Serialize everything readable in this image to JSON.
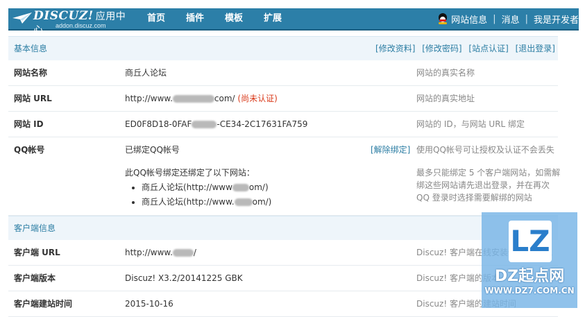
{
  "nav": {
    "brand": "DISCUZ!",
    "brand_suffix": "应用中心",
    "sub_url": "addon.discuz.com",
    "menu": [
      "首页",
      "插件",
      "模板",
      "扩展"
    ],
    "site_info": "网站信息",
    "messages": "消息",
    "developer": "我是开发者",
    "separator": "|"
  },
  "basic": {
    "title": "基本信息",
    "actions": [
      "[修改资料]",
      "[修改密码]",
      "[站点认证]",
      "[退出登录]"
    ],
    "site_name": {
      "label": "网站名称",
      "value": "商丘人论坛",
      "hint": "网站的真实名称"
    },
    "site_url": {
      "label": "网站 URL",
      "value_prefix": "http://www.",
      "value_suffix": "com/",
      "status": "(尚未认证)",
      "hint": "网站的真实地址"
    },
    "site_id": {
      "label": "网站 ID",
      "value_prefix": "ED0F8D18-0FAF",
      "value_suffix": "-CE34-2C17631FA759",
      "hint": "网站的 ID，与网站 URL 绑定"
    },
    "qq": {
      "label": "QQ帐号",
      "value": "已绑定QQ帐号",
      "unbind": "[解除绑定]",
      "hint": "使用QQ帐号可让授权及认证不会丢失",
      "bound_intro": "此QQ帐号绑定还绑定了以下网站：",
      "bound_sites": [
        {
          "prefix": "商丘人论坛(http://www",
          "suffix": "om/)"
        },
        {
          "prefix": "商丘人论坛(http://www.",
          "suffix": "om/)"
        }
      ],
      "note": "最多只能绑定 5 个客户端网站，如需解绑这些网站请先退出登录，并在再次 QQ 登录时选择需要解绑的网站"
    }
  },
  "client": {
    "title": "客户端信息",
    "url": {
      "label": "客户端 URL",
      "value_prefix": "http://www.",
      "value_suffix": "/",
      "hint": "Discuz! 客户端在线安装使用的 URL"
    },
    "version": {
      "label": "客户端版本",
      "value": "Discuz! X3.2/20141225 GBK",
      "hint": "Discuz! 客户端的版本"
    },
    "created": {
      "label": "客户端建站时间",
      "value": "2015-10-16",
      "hint": "Discuz! 客户端的建站时间"
    }
  },
  "watermark": {
    "logo_letters": "LZ",
    "title": "DZ起点网",
    "url": "WWW.DZ7.COM.CN"
  }
}
